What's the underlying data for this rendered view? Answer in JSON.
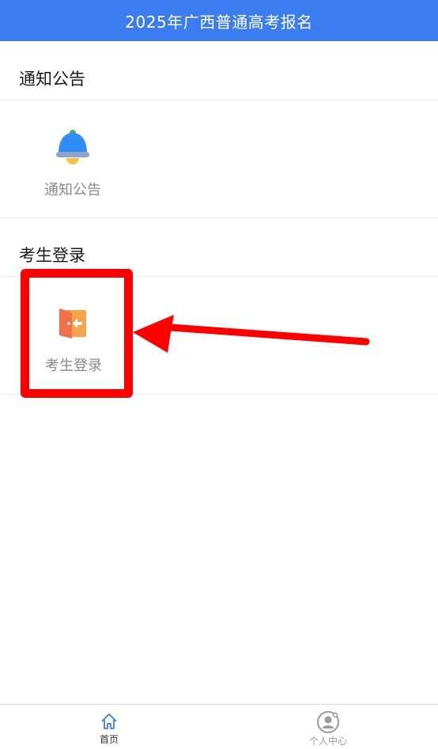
{
  "header": {
    "title": "2025年广西普通高考报名"
  },
  "sections": [
    {
      "title": "通知公告",
      "tiles": [
        {
          "label": "通知公告",
          "icon": "bell-icon"
        }
      ]
    },
    {
      "title": "考生登录",
      "tiles": [
        {
          "label": "考生登录",
          "icon": "login-door-icon"
        }
      ]
    }
  ],
  "tabbar": [
    {
      "label": "首页",
      "icon": "home-icon",
      "active": true
    },
    {
      "label": "个人中心",
      "icon": "user-center-icon",
      "active": false
    }
  ],
  "colors": {
    "header_bg": "#3b7df0",
    "highlight": "#ff0000",
    "tab_active": "#3b7df0",
    "tab_inactive": "#9a9a9a"
  }
}
